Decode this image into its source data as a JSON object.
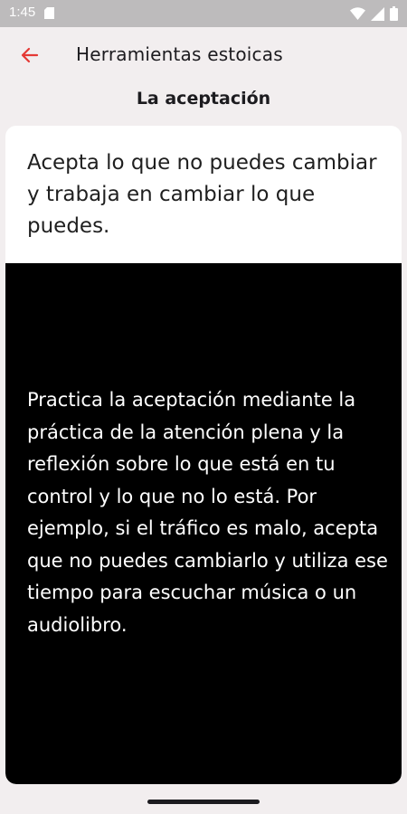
{
  "status_bar": {
    "time": "1:45"
  },
  "app_bar": {
    "title": "Herramientas estoicas",
    "back_icon": "arrow-left-icon",
    "accent": "#e53935"
  },
  "section": {
    "title": "La aceptación"
  },
  "card": {
    "quote": "Acepta lo que no puedes cambiar y trabaja en cambiar lo que puedes.",
    "body": "Practica la aceptación mediante la práctica de la atención plena y la reflexión sobre lo que está en tu control y lo que no lo está. Por ejemplo, si el tráfico es malo, acepta que no puedes cambiarlo y utiliza ese tiempo para escuchar música o un audiolibro."
  }
}
